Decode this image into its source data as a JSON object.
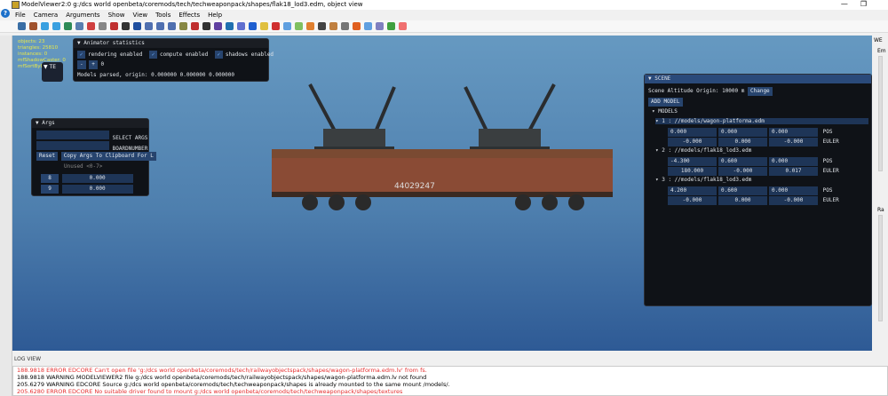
{
  "window": {
    "title": "ModelViewer2:0 g:/dcs world openbeta/coremods/tech/techweaponpack/shapes/flak18_lod3.edm, object view",
    "minimize": "—",
    "restore": "❐"
  },
  "menu": [
    "File",
    "Camera",
    "Arguments",
    "Show",
    "View",
    "Tools",
    "Effects",
    "Help"
  ],
  "toolbar_colors": [
    "#3a6ea5",
    "#a0522d",
    "#3aa0e0",
    "#3aa0e0",
    "#2e8b57",
    "#5a7fb0",
    "#d04040",
    "#888",
    "#c03030",
    "#333",
    "#2050a0",
    "#5070b0",
    "#5070b0",
    "#5070b0",
    "#884",
    "#c03030",
    "#333",
    "#6040a0",
    "#2070b0",
    "#6070d0",
    "#2060d0",
    "#e0c040",
    "#d03030",
    "#60a0e0",
    "#80c060",
    "#e08030",
    "#444",
    "#c08040",
    "#777",
    "#e06020",
    "#60a0e0",
    "#8080c0",
    "#40a040",
    "#f07070"
  ],
  "stats": [
    "objects: 23",
    "triangles: 25810",
    "instances: 0",
    "mfShadowCaster: 0",
    "mfSortByD... TE: 0"
  ],
  "tex_label": "TE",
  "animator": {
    "title": "Animator statistics",
    "checks": [
      {
        "label": "rendering enabled",
        "checked": true
      },
      {
        "label": "compute enabled",
        "checked": true
      },
      {
        "label": "shadows enabled",
        "checked": true
      }
    ],
    "minus": "-",
    "plus": "+",
    "value": "0",
    "models_parsed": "Models parsed, origin: 0.000000 0.000000 0.000000"
  },
  "args": {
    "title": "Args",
    "select_label": "SELECT ARGS",
    "boardnumber_label": "BOARDNUMBER",
    "reset": "Reset",
    "copy": "Copy Args To Clipboard For L",
    "unused": "Unused <0-7>",
    "rows": [
      {
        "idx": "8",
        "value": "0.000"
      },
      {
        "idx": "9",
        "value": "0.000"
      }
    ]
  },
  "scene": {
    "title": "SCENE",
    "altitude": "Scene Altitude Origin: 10000 m",
    "change": "Change",
    "add_model": "ADD MODEL",
    "models_label": "MODELS",
    "models": [
      {
        "name": "1 : //models/wagon-platforma.edm",
        "pos": [
          "0.000",
          "0.000",
          "0.000"
        ],
        "euler": [
          "-0.000",
          "0.000",
          "-0.000"
        ]
      },
      {
        "name": "2 : //models/flak18_lod3.edm",
        "pos": [
          "-4.300",
          "0.600",
          "0.000"
        ],
        "euler": [
          "180.000",
          "-0.000",
          "0.017"
        ]
      },
      {
        "name": "3 : //models/flak18_lod3.edm",
        "pos": [
          "4.200",
          "0.600",
          "0.000"
        ],
        "euler": [
          "-0.000",
          "0.000",
          "-0.000"
        ]
      }
    ],
    "pos_label": "POS",
    "euler_label": "EULER"
  },
  "right_panel": {
    "we": "WE",
    "em": "Em",
    "ra": "Ra"
  },
  "wagon_number": "44029247",
  "log": {
    "title": "LOG VIEW",
    "lines": [
      {
        "text": "188.9818 ERROR EDCORE Can't open file 'g:/dcs world openbeta/coremods/tech/railwayobjectspack/shapes/wagon-platforma.edm.lv' from fs.",
        "level": "error"
      },
      {
        "text": "188.9818 WARNING MODELVIEWER2 file g:/dcs world openbeta/coremods/tech/railwayobjectspack/shapes/wagon-platforma.edm.lv not found",
        "level": "warning"
      },
      {
        "text": "205.6279 WARNING EDCORE Source g:/dcs world openbeta/coremods/tech/techweaponpack/shapes is already mounted to the same mount /models/.",
        "level": "warning"
      },
      {
        "text": "205.6280 ERROR EDCORE No suitable driver found to mount g:/dcs world openbeta/coremods/tech/techweaponpack/shapes/textures",
        "level": "error"
      }
    ]
  }
}
